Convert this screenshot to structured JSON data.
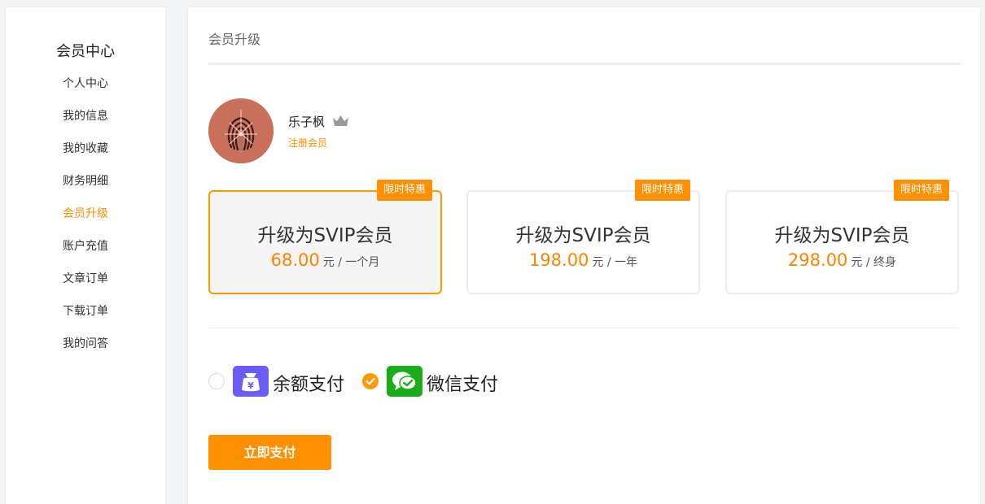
{
  "sidebar": {
    "title": "会员中心",
    "items": [
      {
        "label": "个人中心",
        "active": false
      },
      {
        "label": "我的信息",
        "active": false
      },
      {
        "label": "我的收藏",
        "active": false
      },
      {
        "label": "财务明细",
        "active": false
      },
      {
        "label": "会员升级",
        "active": true
      },
      {
        "label": "账户充值",
        "active": false
      },
      {
        "label": "文章订单",
        "active": false
      },
      {
        "label": "下载订单",
        "active": false
      },
      {
        "label": "我的问答",
        "active": false
      }
    ]
  },
  "main": {
    "header": "会员升级",
    "user": {
      "name": "乐子枫",
      "level": "注册会员",
      "crown_icon": "crown-icon"
    },
    "plans": [
      {
        "badge": "限时特惠",
        "title": "升级为SVIP会员",
        "price": "68.00",
        "unit": "元 / 一个月",
        "selected": true
      },
      {
        "badge": "限时特惠",
        "title": "升级为SVIP会员",
        "price": "198.00",
        "unit": "元 / 一年",
        "selected": false
      },
      {
        "badge": "限时特惠",
        "title": "升级为SVIP会员",
        "price": "298.00",
        "unit": "元 / 终身",
        "selected": false
      }
    ],
    "payment_methods": [
      {
        "label": "余额支付",
        "icon": "wallet-icon",
        "selected": false
      },
      {
        "label": "微信支付",
        "icon": "wechat-icon",
        "selected": true
      }
    ],
    "pay_button": "立即支付"
  },
  "colors": {
    "accent": "#ff9000",
    "price": "#ff8200",
    "wallet_icon_bg": "#6a5cf6",
    "wechat_icon_bg": "#1aad19"
  }
}
